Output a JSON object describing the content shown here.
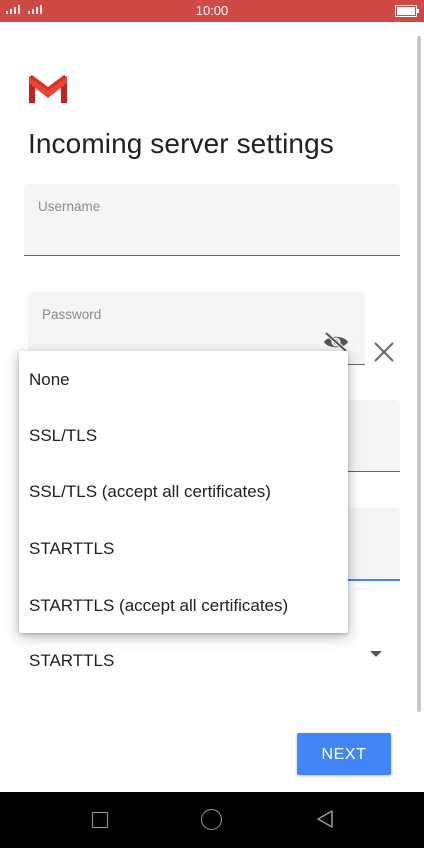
{
  "status_bar": {
    "time": "10:00",
    "icons": [
      "signal-icon",
      "signal-icon",
      "battery-icon"
    ]
  },
  "app": {
    "logo": "gmail-logo"
  },
  "page": {
    "title": "Incoming server settings"
  },
  "form": {
    "username": {
      "label": "Username",
      "value": ""
    },
    "password": {
      "label": "Password",
      "value": "",
      "visibility_icon": "eye-off-icon",
      "clear_icon": "close-icon"
    },
    "security": {
      "selected": "STARTTLS",
      "icon": "dropdown-arrow-icon"
    }
  },
  "security_menu": {
    "options": [
      "None",
      "SSL/TLS",
      "SSL/TLS (accept all certificates)",
      "STARTTLS",
      "STARTTLS (accept all certificates)"
    ]
  },
  "actions": {
    "next_label": "NEXT",
    "next_color": "#4285f4"
  },
  "navigation_bar": {
    "icons": [
      "recent-apps-icon",
      "home-icon",
      "back-icon"
    ]
  },
  "colors": {
    "status_bar": "#cf4a45",
    "accent": "#4285f4"
  }
}
